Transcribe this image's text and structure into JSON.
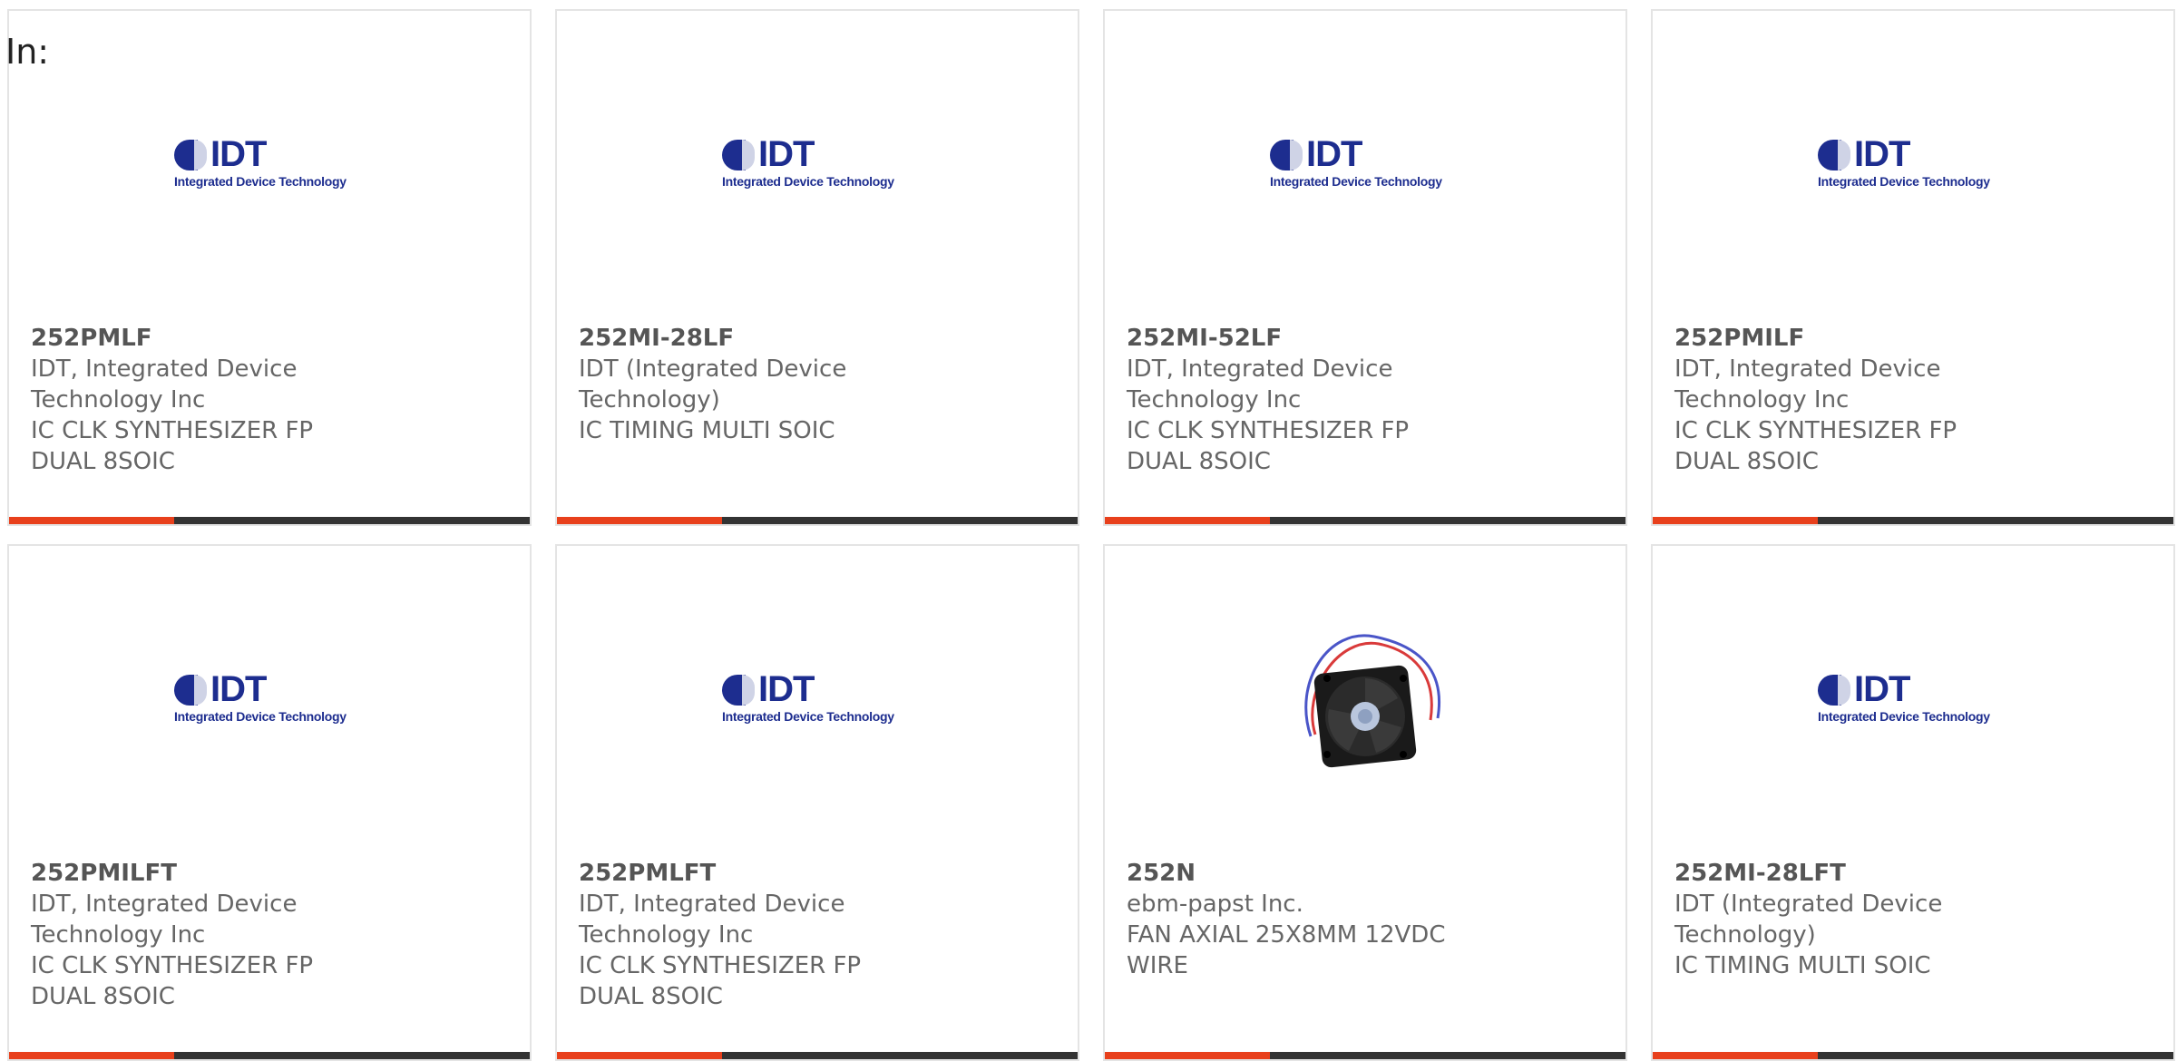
{
  "filter_label": "In:",
  "colors": {
    "accent": "#e8401c",
    "bar": "#333333",
    "text": "#666666",
    "idt_brand": "#1d2d8f"
  },
  "products": [
    {
      "part_number": "252PMLF",
      "manufacturer": "IDT, Integrated Device Technology Inc",
      "description": "IC CLK SYNTHESIZER FP DUAL 8SOIC",
      "image": "idt-logo"
    },
    {
      "part_number": "252MI-28LF",
      "manufacturer": "IDT (Integrated Device Technology)",
      "description": "IC TIMING MULTI SOIC",
      "image": "idt-logo"
    },
    {
      "part_number": "252MI-52LF",
      "manufacturer": "IDT, Integrated Device Technology Inc",
      "description": "IC CLK SYNTHESIZER FP DUAL 8SOIC",
      "image": "idt-logo"
    },
    {
      "part_number": "252PMILF",
      "manufacturer": "IDT, Integrated Device Technology Inc",
      "description": "IC CLK SYNTHESIZER FP DUAL 8SOIC",
      "image": "idt-logo"
    },
    {
      "part_number": "252PMILFT",
      "manufacturer": "IDT, Integrated Device Technology Inc",
      "description": "IC CLK SYNTHESIZER FP DUAL 8SOIC",
      "image": "idt-logo"
    },
    {
      "part_number": "252PMLFT",
      "manufacturer": "IDT, Integrated Device Technology Inc",
      "description": "IC CLK SYNTHESIZER FP DUAL 8SOIC",
      "image": "idt-logo"
    },
    {
      "part_number": "252N",
      "manufacturer": "ebm-papst Inc.",
      "description": "FAN AXIAL 25X8MM 12VDC WIRE",
      "image": "fan-photo"
    },
    {
      "part_number": "252MI-28LFT",
      "manufacturer": "IDT (Integrated Device Technology)",
      "description": "IC TIMING MULTI SOIC",
      "image": "idt-logo"
    }
  ],
  "idt_logo": {
    "wordmark": "IDT",
    "tagline": "Integrated Device Technology"
  }
}
